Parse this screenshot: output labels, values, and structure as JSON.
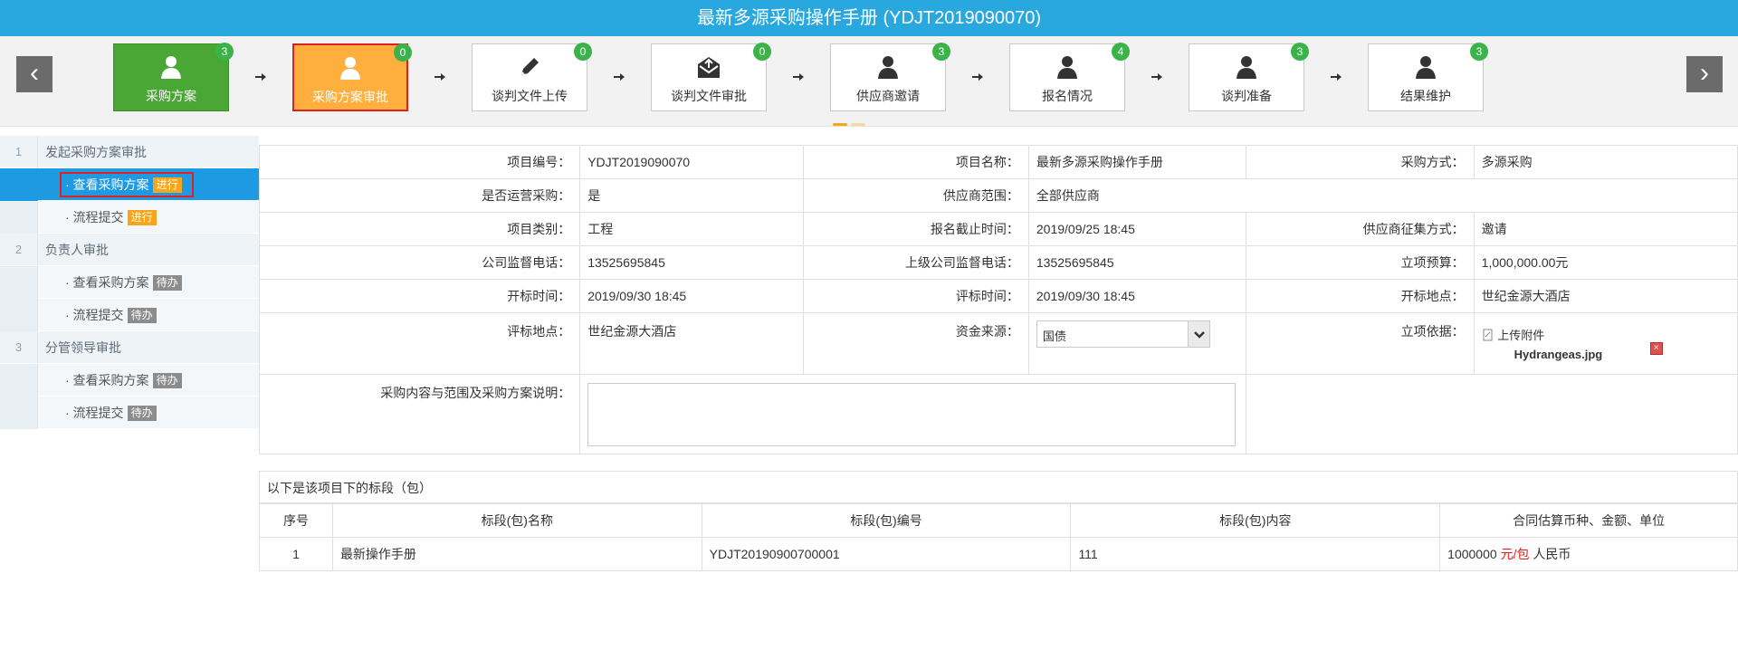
{
  "title": "最新多源采购操作手册 (YDJT2019090070)",
  "stepper": {
    "steps": [
      {
        "label": "采购方案",
        "count": "3",
        "icon": "user-icon"
      },
      {
        "label": "采购方案审批",
        "count": "0",
        "icon": "user-icon"
      },
      {
        "label": "谈判文件上传",
        "count": "0",
        "icon": "pencil-icon"
      },
      {
        "label": "谈判文件审批",
        "count": "0",
        "icon": "envelope-icon"
      },
      {
        "label": "供应商邀请",
        "count": "3",
        "icon": "user-icon"
      },
      {
        "label": "报名情况",
        "count": "4",
        "icon": "user-icon"
      },
      {
        "label": "谈判准备",
        "count": "3",
        "icon": "user-icon"
      },
      {
        "label": "结果维护",
        "count": "3",
        "icon": "user-icon"
      }
    ]
  },
  "sidebar": {
    "groups": [
      {
        "num": "1",
        "title": "发起采购方案审批",
        "items": [
          {
            "label": "· 查看采购方案",
            "tag": "进行"
          },
          {
            "label": "· 流程提交",
            "tag": "进行"
          }
        ]
      },
      {
        "num": "2",
        "title": "负责人审批",
        "items": [
          {
            "label": "· 查看采购方案",
            "tag": "待办"
          },
          {
            "label": "· 流程提交",
            "tag": "待办"
          }
        ]
      },
      {
        "num": "3",
        "title": "分管领导审批",
        "items": [
          {
            "label": "· 查看采购方案",
            "tag": "待办"
          },
          {
            "label": "· 流程提交",
            "tag": "待办"
          }
        ]
      }
    ]
  },
  "form": {
    "project_no_label": "项目编号：",
    "project_no": "YDJT2019090070",
    "project_name_label": "项目名称：",
    "project_name": "最新多源采购操作手册",
    "method_label": "采购方式：",
    "method": "多源采购",
    "ops_label": "是否运营采购：",
    "ops": "是",
    "scope_label": "供应商范围：",
    "scope": "全部供应商",
    "category_label": "项目类别：",
    "category": "工程",
    "deadline_label": "报名截止时间：",
    "deadline": "2019/09/25 18:45",
    "collect_label": "供应商征集方式：",
    "collect": "邀请",
    "phone_label": "公司监督电话：",
    "phone": "13525695845",
    "parent_phone_label": "上级公司监督电话：",
    "parent_phone": "13525695845",
    "budget_label": "立项预算：",
    "budget": "1,000,000.00元",
    "open_time_label": "开标时间：",
    "open_time": "2019/09/30 18:45",
    "eval_time_label": "评标时间：",
    "eval_time": "2019/09/30 18:45",
    "open_place_label": "开标地点：",
    "open_place": "世纪金源大酒店",
    "eval_place_label": "评标地点：",
    "eval_place": "世纪金源大酒店",
    "fund_label": "资金来源：",
    "fund": "国债",
    "basis_label": "立项依据：",
    "upload": "上传附件",
    "filename": "Hydrangeas.jpg",
    "content_label": "采购内容与范围及采购方案说明："
  },
  "packages": {
    "caption": "以下是该项目下的标段（包）",
    "headers": [
      "序号",
      "标段(包)名称",
      "标段(包)编号",
      "标段(包)内容",
      "合同估算币种、金额、单位"
    ],
    "rows": [
      {
        "no": "1",
        "name": "最新操作手册",
        "code": "YDJT20190900700001",
        "content": "111",
        "amount": "1000000",
        "unit": "元/包",
        "currency": "人民币"
      }
    ]
  },
  "colors": {
    "header": "#29a8e0",
    "done": "#4aa635",
    "active": "#ffaf3d",
    "selected": "#1d9ae2",
    "badge": "#3bb34a"
  }
}
